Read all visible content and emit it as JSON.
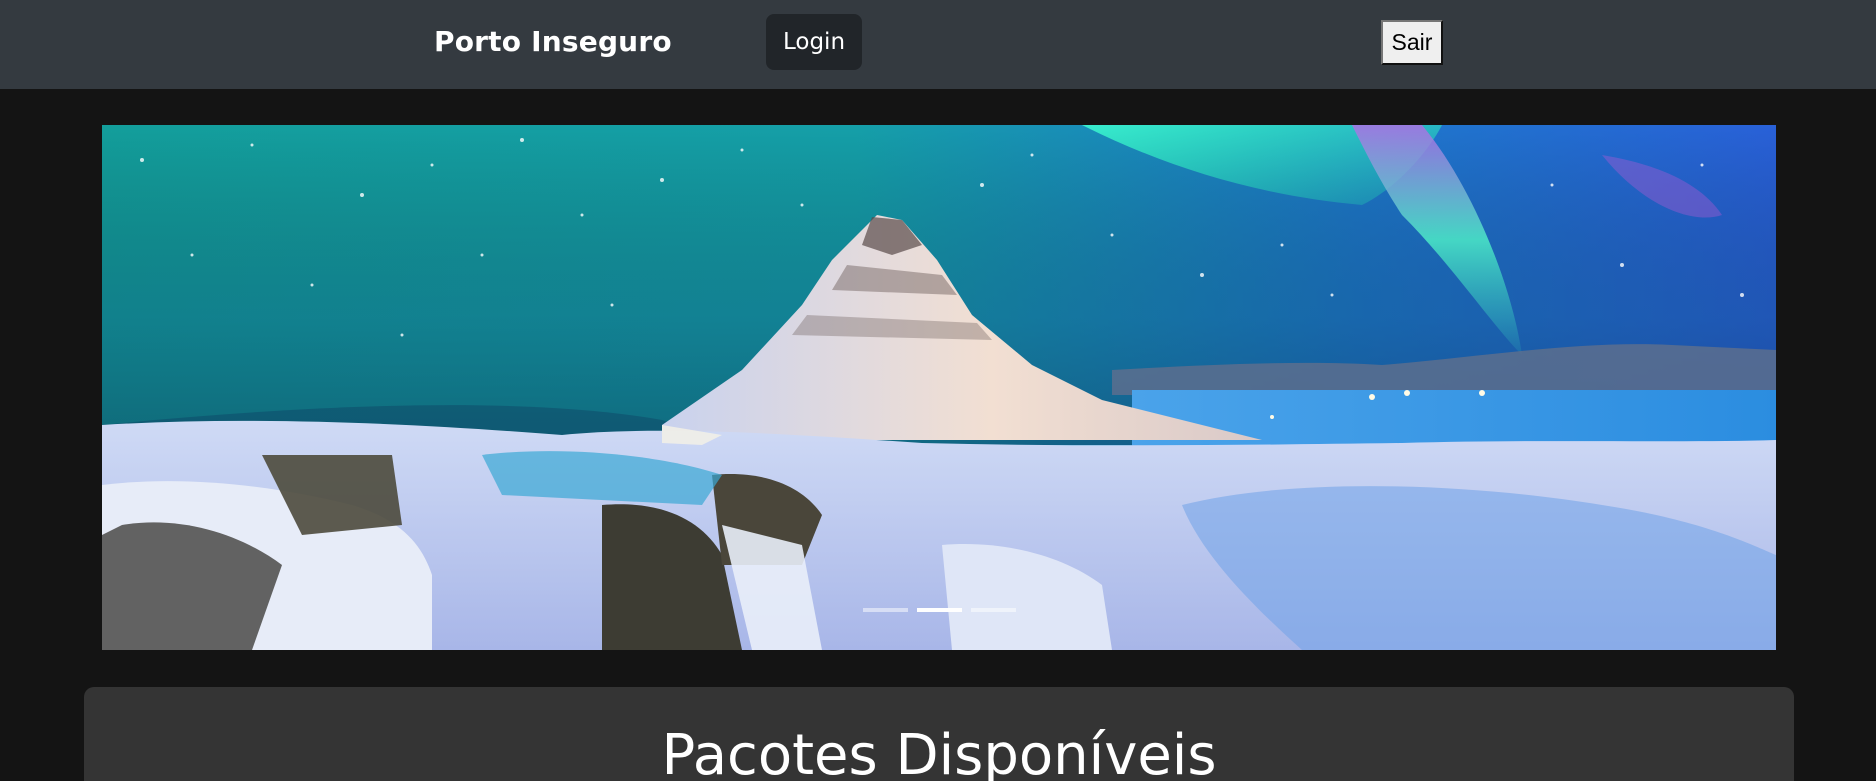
{
  "navbar": {
    "brand": "Porto Inseguro",
    "login_label": "Login",
    "logout_label": "Sair",
    "background": "#343a40"
  },
  "carousel": {
    "image_subject": "aurora-over-snowy-mountain",
    "slide_count": 3,
    "active_index": 1
  },
  "packages": {
    "title": "Pacotes Disponíveis"
  }
}
